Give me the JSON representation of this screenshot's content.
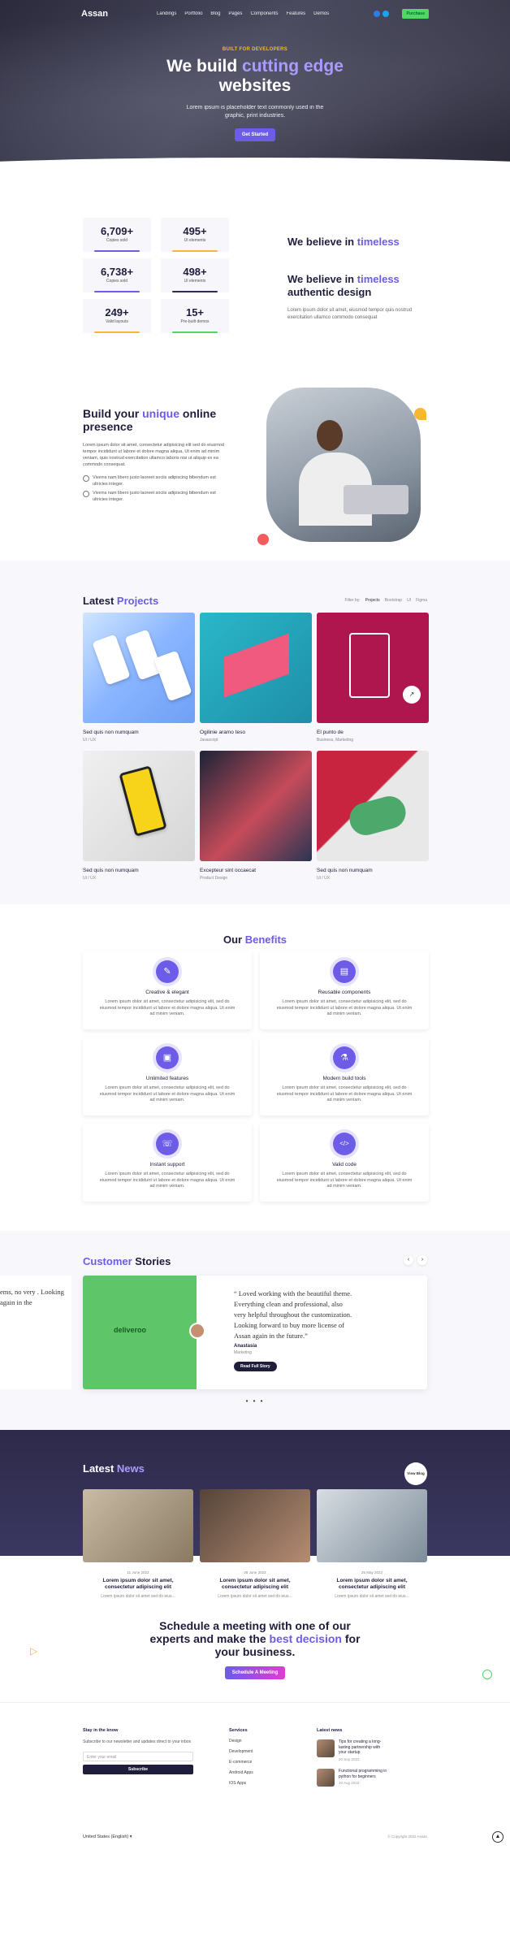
{
  "nav": {
    "logo": "Assan",
    "items": [
      "Landings",
      "Portfolio",
      "Blog",
      "Pages",
      "Components",
      "Features",
      "Demos"
    ],
    "buy": "Purchase"
  },
  "hero": {
    "tag": "BUILT FOR DEVELOPERS",
    "title_a": "We build ",
    "title_accent": "cutting edge",
    "title_b": "websites",
    "text": "Lorem ipsum is placeholder text commonly used in the graphic, print industries.",
    "cta": "Get Started"
  },
  "stats": [
    {
      "value": "6,709+",
      "label": "Copies sold",
      "color": "#6c5ce7"
    },
    {
      "value": "495+",
      "label": "UI elements",
      "color": "#f7b731"
    },
    {
      "value": "6,738+",
      "label": "Copies sold",
      "color": "#6c5ce7"
    },
    {
      "value": "498+",
      "label": "UI elements",
      "color": "#2c2b5c"
    },
    {
      "value": "249+",
      "label": "Valid layouts",
      "color": "#f7b731"
    },
    {
      "value": "15+",
      "label": "Pre-built demos",
      "color": "#4cd964"
    }
  ],
  "believe": {
    "h1": "We believe in ",
    "h1_accent": "timeless",
    "h2": "We believe in ",
    "h2_accent": "timeless",
    "h2_tail": "authentic design",
    "text": "Lorem ipsum dolor sit amet, eiusmod tempor quis nostrud exercitation ullamco commodo consequat"
  },
  "online": {
    "title_a": "Build your ",
    "title_accent": "unique",
    "title_b": " online presence",
    "desc": "Lorem ipsum dolor sit amet, consectetur adipisicing elit sed do eiusmod tempor incididunt ut labore et dolore magna aliqua. Ut enim ad minim veniam, quis nostrud exercitation ullamco laboris nisi ut aliquip ex ea commodo consequat.",
    "checks": [
      "Viverra nam libero justo laoreet sociis adipiscing bibendum est ultricies integer.",
      "Viverra nam libero justo laoreet sociis adipiscing bibendum est ultricies integer."
    ]
  },
  "projects": {
    "title_a": "Latest ",
    "title_accent": "Projects",
    "filter": [
      "Filter by:",
      "Projects",
      "Bootstrap",
      "UI",
      "Figma"
    ],
    "items": [
      {
        "title": "Sed quis non numquam",
        "sub": "UI / UX"
      },
      {
        "title": "Ogilinie aramo teso",
        "sub": "Javascript"
      },
      {
        "title": "El punto de",
        "sub": "Business, Marketing"
      },
      {
        "title": "Sed quis non numquam",
        "sub": "UI / UX"
      },
      {
        "title": "Excepteur sint occaecat",
        "sub": "Product Design"
      },
      {
        "title": "Sed quis non numquam",
        "sub": "UI / UX"
      }
    ]
  },
  "benefits": {
    "title_a": "Our ",
    "title_accent": "Benefits",
    "items": [
      {
        "title": "Creative & elegant",
        "icon": "palette-icon",
        "glyph": "✎",
        "text": "Lorem ipsum dolor sit amet, consectetur adipisicing elit, sed do eiusmod tempor incididunt ut labore et dolore magna aliqua. Ut enim ad minim veniam."
      },
      {
        "title": "Reusable components",
        "icon": "layers-icon",
        "glyph": "▤",
        "text": "Lorem ipsum dolor sit amet, consectetur adipisicing elit, sed do eiusmod tempor incididunt ut labore et dolore magna aliqua. Ut enim ad minim veniam."
      },
      {
        "title": "Unlimited features",
        "icon": "box-icon",
        "glyph": "▣",
        "text": "Lorem ipsum dolor sit amet, consectetur adipisicing elit, sed do eiusmod tempor incididunt ut labore et dolore magna aliqua. Ut enim ad minim veniam."
      },
      {
        "title": "Modern build tools",
        "icon": "cup-icon",
        "glyph": "⚗",
        "text": "Lorem ipsum dolor sit amet, consectetur adipisicing elit, sed do eiusmod tempor incididunt ut labore et dolore magna aliqua. Ut enim ad minim veniam."
      },
      {
        "title": "Instant support",
        "icon": "mic-icon",
        "glyph": "☏",
        "text": "Lorem ipsum dolor sit amet, consectetur adipisicing elit, sed do eiusmod tempor incididunt ut labore et dolore magna aliqua. Ut enim ad minim veniam."
      },
      {
        "title": "Valid code",
        "icon": "code-icon",
        "glyph": "</>",
        "text": "Lorem ipsum dolor sit amet, consectetur adipisicing elit, sed do eiusmod tempor incididunt ut labore et dolore magna aliqua. Ut enim ad minim veniam."
      }
    ]
  },
  "stories": {
    "title_a": "Customer ",
    "title_b": "Stories",
    "ghost": "ems, no very . Looking again in the",
    "brand": "deliveroo",
    "quote": "“ Loved working with the beautiful theme. Everything clean and professional, also very helpful throughout the customization. Looking forward to buy more license of Assan again in the future.”",
    "name": "Anastasia",
    "role": "Marketing",
    "btn": "Read Full Story"
  },
  "news": {
    "title_a": "Latest ",
    "title_accent": "News",
    "viewall": "View Blog",
    "items": [
      {
        "date": "11 June 2022",
        "title": "Lorem ipsum dolor sit amet, consectetur adipiscing elit",
        "excerpt": "Lorem ipsum dolor sit amet sed do eius..."
      },
      {
        "date": "08 June 2022",
        "title": "Lorem ipsum dolor sit amet, consectetur adipiscing elit",
        "excerpt": "Lorem ipsum dolor sit amet sed do eius..."
      },
      {
        "date": "25 May 2022",
        "title": "Lorem ipsum dolor sit amet, consectetur adipiscing elit",
        "excerpt": "Lorem ipsum dolor sit amet sed do eius..."
      }
    ]
  },
  "schedule": {
    "a": "Schedule a meeting with one of our experts and make the ",
    "accent": "best decision",
    "b": " for your business.",
    "btn": "Schedule A Meeting"
  },
  "footer": {
    "stay": "Stay in the know",
    "stay_text": "Subscribe to our newsletter and updates direct to your inbox",
    "email_ph": "Enter your email",
    "subscribe": "Subscribe",
    "services": "Services",
    "links": [
      "Design",
      "Development",
      "E-commerce",
      "Android Apps",
      "IOS Apps"
    ],
    "latest": "Latest news",
    "posts": [
      {
        "title": "Tips for creating a long-lasting partnership with your startup",
        "date": "20 Sep 2022"
      },
      {
        "title": "Functional programming in python for beginners",
        "date": "20 Aug 2022"
      }
    ],
    "lang": "United States (English) ▾",
    "copy": "© Copyright 2022 Assan"
  }
}
